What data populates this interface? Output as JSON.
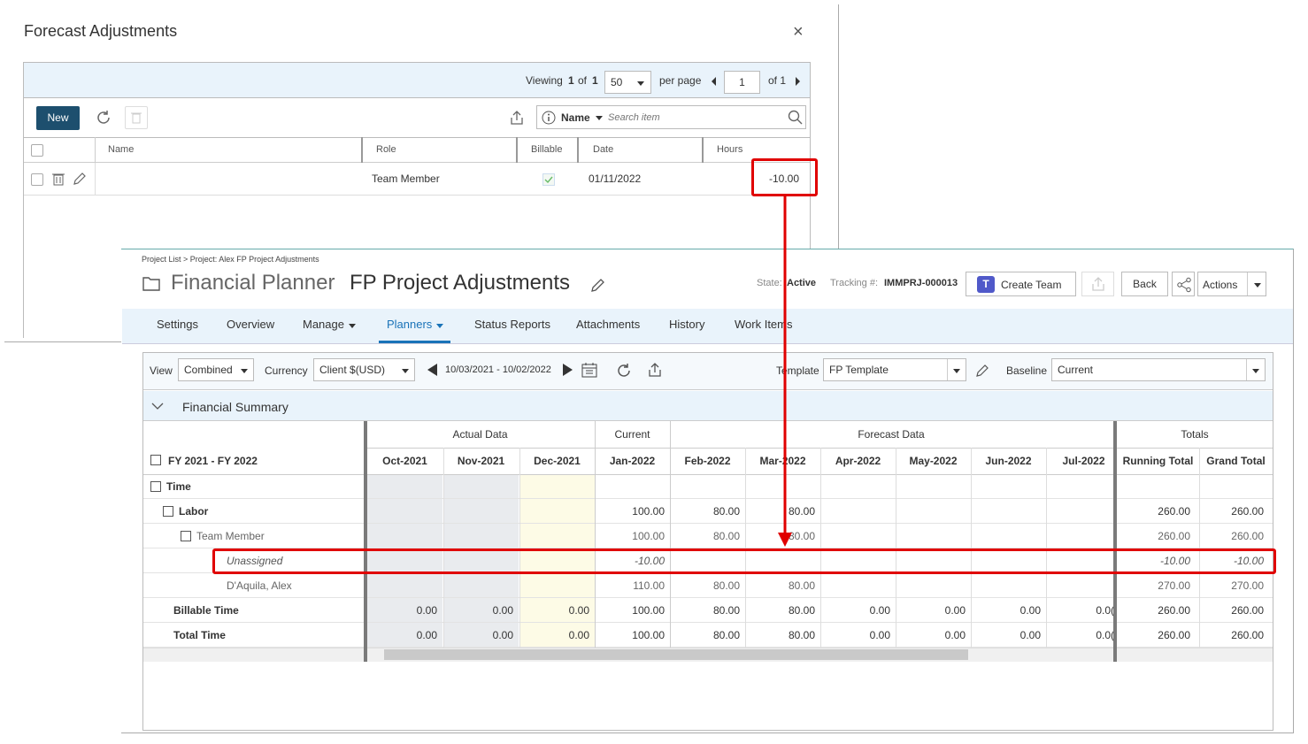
{
  "modal": {
    "title": "Forecast Adjustments",
    "close_glyph": "×",
    "pager": {
      "viewing": "Viewing",
      "page_current": "1",
      "of": "of",
      "page_total": "1",
      "per_page_value": "50",
      "per_page_label": "per page",
      "page_input": "1",
      "of_pages": "of 1"
    },
    "new_label": "New",
    "search": {
      "field": "Name",
      "placeholder": "Search item"
    },
    "columns": [
      "Name",
      "Role",
      "Billable",
      "Date",
      "Hours"
    ],
    "row": {
      "name": "",
      "role": "Team Member",
      "billable": true,
      "date": "01/11/2022",
      "hours": "-10.00"
    }
  },
  "main": {
    "breadcrumb": "Project List > Project: Alex FP Project Adjustments",
    "planner_label": "Financial Planner",
    "project_name": "FP Project Adjustments",
    "state_label": "State:",
    "state_value": "Active",
    "tracking_label": "Tracking #:",
    "tracking_value": "IMMPRJ-000013",
    "create_team": "Create Team",
    "back": "Back",
    "actions": "Actions",
    "tabs": [
      "Settings",
      "Overview",
      "Manage",
      "Planners",
      "Status Reports",
      "Attachments",
      "History",
      "Work Items"
    ],
    "active_tab": "Planners",
    "toolbar": {
      "view_label": "View",
      "view_value": "Combined",
      "currency_label": "Currency",
      "currency_value": "Client $(USD)",
      "date_range": "10/03/2021 - 10/02/2022",
      "template_label": "Template",
      "template_value": "FP Template",
      "baseline_label": "Baseline",
      "baseline_value": "Current"
    },
    "section_title": "Financial Summary",
    "groups": {
      "actual": "Actual Data",
      "current": "Current",
      "forecast": "Forecast Data",
      "totals": "Totals"
    },
    "fy_label": "FY 2021 - FY 2022",
    "months": [
      "Oct-2021",
      "Nov-2021",
      "Dec-2021",
      "Jan-2022",
      "Feb-2022",
      "Mar-2022",
      "Apr-2022",
      "May-2022",
      "Jun-2022",
      "Jul-2022"
    ],
    "total_cols": [
      "Running Total",
      "Grand Total"
    ],
    "rows": [
      {
        "label": "Time",
        "values": [
          "",
          "",
          "",
          "",
          "",
          "",
          "",
          "",
          "",
          ""
        ],
        "totals": [
          "",
          ""
        ]
      },
      {
        "label": "Labor",
        "values": [
          "",
          "",
          "",
          "100.00",
          "80.00",
          "80.00",
          "",
          "",
          "",
          ""
        ],
        "totals": [
          "260.00",
          "260.00"
        ]
      },
      {
        "label": "Team Member",
        "values": [
          "",
          "",
          "",
          "100.00",
          "80.00",
          "80.00",
          "",
          "",
          "",
          ""
        ],
        "totals": [
          "260.00",
          "260.00"
        ]
      },
      {
        "label": "Unassigned",
        "values": [
          "",
          "",
          "",
          "-10.00",
          "",
          "",
          "",
          "",
          "",
          ""
        ],
        "totals": [
          "-10.00",
          "-10.00"
        ]
      },
      {
        "label": "D'Aquila, Alex",
        "values": [
          "",
          "",
          "",
          "110.00",
          "80.00",
          "80.00",
          "",
          "",
          "",
          ""
        ],
        "totals": [
          "270.00",
          "270.00"
        ]
      },
      {
        "label": "Billable Time",
        "values": [
          "0.00",
          "0.00",
          "0.00",
          "100.00",
          "80.00",
          "80.00",
          "0.00",
          "0.00",
          "0.00",
          "0.0("
        ],
        "totals": [
          "260.00",
          "260.00"
        ]
      },
      {
        "label": "Total Time",
        "values": [
          "0.00",
          "0.00",
          "0.00",
          "100.00",
          "80.00",
          "80.00",
          "0.00",
          "0.00",
          "0.00",
          "0.0("
        ],
        "totals": [
          "260.00",
          "260.00"
        ]
      }
    ],
    "colors": {
      "accent": "#1d4f6e",
      "tab_active": "#1a73b8",
      "highlight": "#e00000"
    }
  }
}
